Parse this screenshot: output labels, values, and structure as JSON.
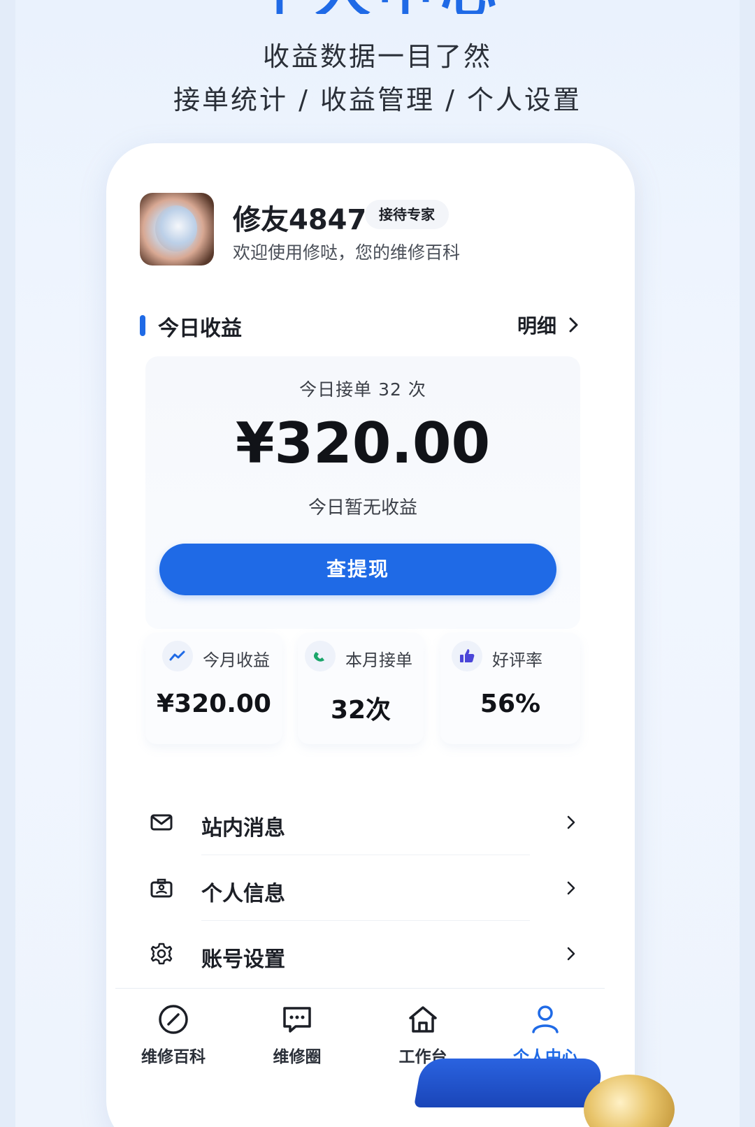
{
  "hero": {
    "title_partial": "个人中心",
    "line1": "收益数据一目了然",
    "line2": "接单统计 / 收益管理 / 个人设置"
  },
  "profile": {
    "nickname": "修友4847",
    "badge": "接待专家",
    "welcome": "欢迎使用修哒，您的维修百科"
  },
  "today": {
    "section_title": "今日收益",
    "detail_label": "明细",
    "orders_text": "今日接单 32 次",
    "amount": "¥320.00",
    "no_income_text": "今日暂无收益",
    "withdraw_label": "查提现"
  },
  "stats": [
    {
      "label": "今月收益",
      "value": "¥320.00",
      "icon": "trend-up-icon",
      "icon_color": "#1f6ae6"
    },
    {
      "label": "本月接单",
      "value": "32次",
      "icon": "phone-icon",
      "icon_color": "#1aa56a"
    },
    {
      "label": "好评率",
      "value": "56%",
      "icon": "thumbs-up-icon",
      "icon_color": "#4a45d8"
    }
  ],
  "menu": [
    {
      "label": "站内消息",
      "icon": "mail-icon"
    },
    {
      "label": "个人信息",
      "icon": "id-card-icon"
    },
    {
      "label": "账号设置",
      "icon": "gear-icon"
    }
  ],
  "tabbar": [
    {
      "label": "维修百科",
      "icon": "compass-icon",
      "active": false
    },
    {
      "label": "维修圈",
      "icon": "chat-icon",
      "active": false
    },
    {
      "label": "工作台",
      "icon": "home-icon",
      "active": false
    },
    {
      "label": "个人中心",
      "icon": "user-icon",
      "active": true
    }
  ],
  "colors": {
    "accent": "#1f6ae6",
    "text": "#1c1f26",
    "muted": "#3b3f47"
  }
}
